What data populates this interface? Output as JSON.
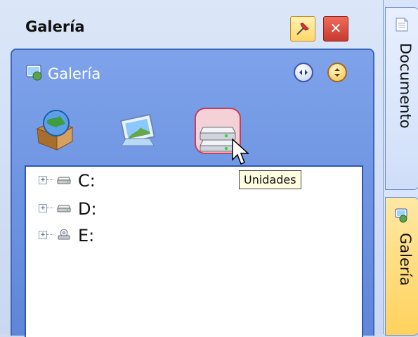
{
  "panel": {
    "title": "Galería"
  },
  "inner": {
    "title": "Galería"
  },
  "tree": [
    {
      "label": "C:"
    },
    {
      "label": "D:"
    },
    {
      "label": "E:"
    }
  ],
  "tooltip": "Unidades",
  "side_tabs": [
    {
      "label": "Documento",
      "icon": "document-icon"
    },
    {
      "label": "Galería",
      "icon": "gallery-icon"
    }
  ],
  "colors": {
    "accent": "#4f78d4",
    "selected_tab": "#ffd25d"
  }
}
